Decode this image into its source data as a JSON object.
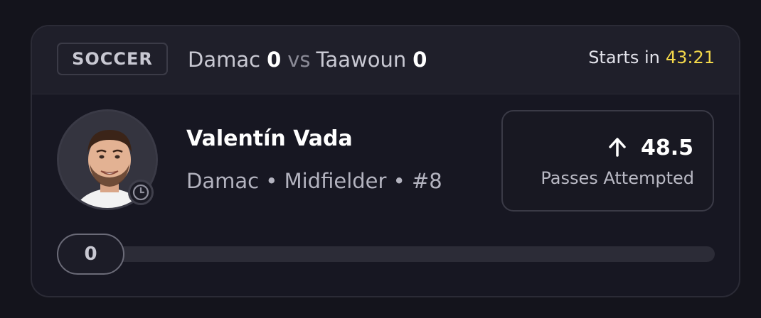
{
  "header": {
    "sport": "SOCCER",
    "home_team": "Damac",
    "home_score": "0",
    "vs": "vs",
    "away_team": "Taawoun",
    "away_score": "0",
    "starts_label": "Starts in",
    "countdown": "43:21"
  },
  "player": {
    "name": "Valentín Vada",
    "meta": "Damac • Midfielder • #8",
    "avatar_icon": "player-photo",
    "status_icon": "clock-icon"
  },
  "stat": {
    "direction_icon": "arrow-up-icon",
    "line": "48.5",
    "label": "Passes Attempted"
  },
  "progress": {
    "current_label": "0",
    "current_value": 0
  },
  "colors": {
    "accent_timer": "#f3d84a",
    "background": "#14141c",
    "card": "#171722"
  }
}
